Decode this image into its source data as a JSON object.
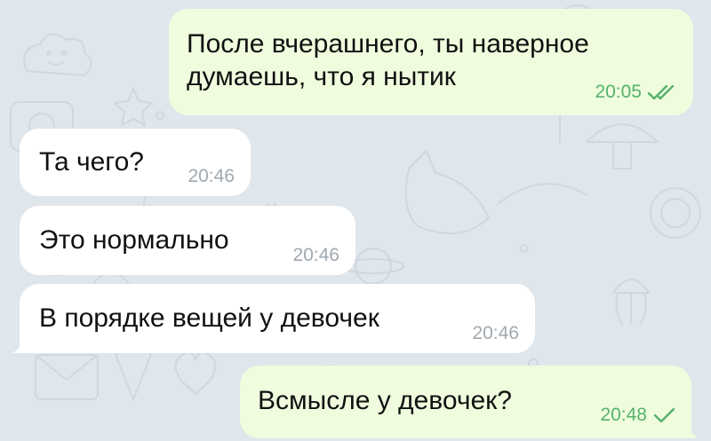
{
  "chat": {
    "accent_color": "#55b26a",
    "incoming_bubble_color": "#ffffff",
    "outgoing_bubble_color": "#effdde",
    "background_color": "#dfe6ec",
    "messages": [
      {
        "direction": "outgoing",
        "lines": [
          "После вчерашнего, ты наверное",
          "думаешь, что я нытик"
        ],
        "time": "20:05",
        "status": "read",
        "status_icon": "double-check-icon"
      },
      {
        "direction": "incoming",
        "text": "Та чего?",
        "time": "20:46"
      },
      {
        "direction": "incoming",
        "text": "Это нормально",
        "time": "20:46"
      },
      {
        "direction": "incoming",
        "text": "В порядке вещей у девочек",
        "time": "20:46"
      },
      {
        "direction": "outgoing",
        "text": "Всмысле у девочек?",
        "time": "20:48",
        "status": "sent",
        "status_icon": "single-check-icon"
      }
    ]
  }
}
